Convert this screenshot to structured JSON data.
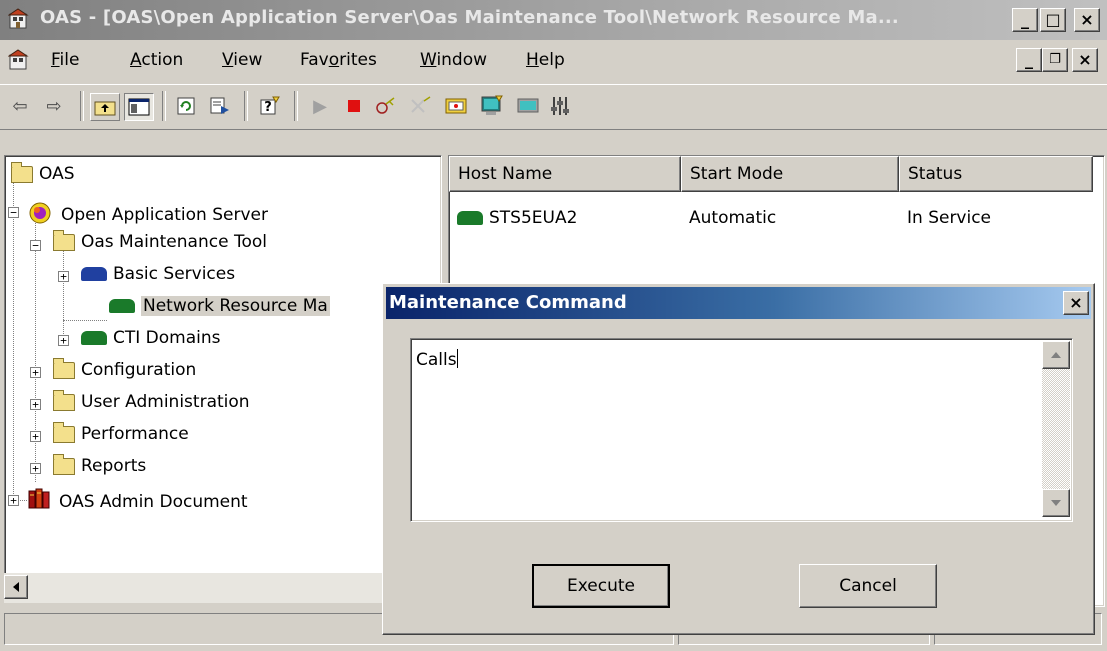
{
  "window": {
    "title": "OAS - [OAS\\Open Application Server\\Oas Maintenance Tool\\Network Resource Ma...",
    "min": "_",
    "max": "□",
    "close": "×"
  },
  "menu": {
    "items": [
      {
        "label": "File",
        "u": "F",
        "rest": "ile"
      },
      {
        "label": "Action",
        "u": "A",
        "rest": "ction"
      },
      {
        "label": "View",
        "u": "V",
        "rest": "iew"
      },
      {
        "label": "Favorites",
        "pre": "Fav",
        "u": "o",
        "rest": "rites"
      },
      {
        "label": "Window",
        "u": "W",
        "rest": "indow"
      },
      {
        "label": "Help",
        "u": "H",
        "rest": "elp"
      }
    ]
  },
  "tree": {
    "root": "OAS",
    "server": "Open Application Server",
    "maintenance_tool": "Oas Maintenance Tool",
    "basic_services": "Basic Services",
    "network_resource": "Network Resource Ma",
    "cti_domains": "CTI Domains",
    "configuration": "Configuration",
    "user_admin": "User Administration",
    "performance": "Performance",
    "reports": "Reports",
    "admin_document": "OAS Admin Document"
  },
  "list": {
    "columns": [
      "Host Name",
      "Start Mode",
      "Status"
    ],
    "rows": [
      {
        "host": "STS5EUA2",
        "start_mode": "Automatic",
        "status": "In Service"
      }
    ]
  },
  "dialog": {
    "title": "Maintenance Command",
    "command_text": "Calls",
    "execute_label": "Execute",
    "cancel_label": "Cancel"
  },
  "colors": {
    "dialog_title_start": "#0a246a",
    "dialog_title_end": "#a6caf0",
    "window_face": "#d4d0c8"
  }
}
